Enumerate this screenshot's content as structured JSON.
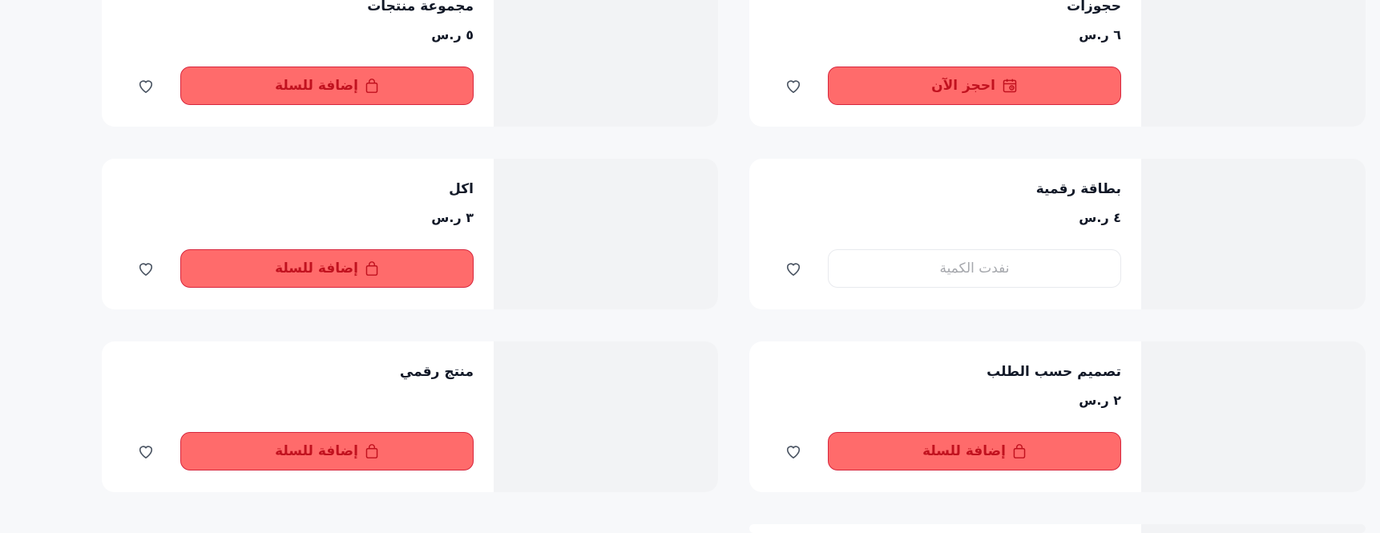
{
  "colors": {
    "page_bg": "#f7f8fa",
    "card_bg": "#ffffff",
    "thumb_bg": "#f2f3f5",
    "primary_bg": "#ff6b6b",
    "primary_text": "#c1121f",
    "disabled_text": "#a6a8ad"
  },
  "products": [
    {
      "name": "حجوزات",
      "price": "٦ ر.س",
      "button": {
        "label": "احجز الآن",
        "icon": "calendar-icon",
        "state": "primary"
      },
      "favorite_icon": "heart-icon"
    },
    {
      "name": "مجموعة منتجات",
      "price": "٥ ر.س",
      "button": {
        "label": "إضافة للسلة",
        "icon": "shopping-bag-icon",
        "state": "primary"
      },
      "favorite_icon": "heart-icon"
    },
    {
      "name": "بطاقة رقمية",
      "price": "٤ ر.س",
      "button": {
        "label": "نفدت الكمية",
        "icon": "",
        "state": "disabled"
      },
      "favorite_icon": "heart-icon"
    },
    {
      "name": "اكل",
      "price": "٣ ر.س",
      "button": {
        "label": "إضافة للسلة",
        "icon": "shopping-bag-icon",
        "state": "primary"
      },
      "favorite_icon": "heart-icon"
    },
    {
      "name": "تصميم حسب الطلب",
      "price": "٢ ر.س",
      "button": {
        "label": "إضافة للسلة",
        "icon": "shopping-bag-icon",
        "state": "primary"
      },
      "favorite_icon": "heart-icon"
    },
    {
      "name": "منتج رقمي",
      "price": "",
      "button": {
        "label": "إضافة للسلة",
        "icon": "shopping-bag-icon",
        "state": "primary"
      },
      "favorite_icon": "heart-icon"
    }
  ]
}
